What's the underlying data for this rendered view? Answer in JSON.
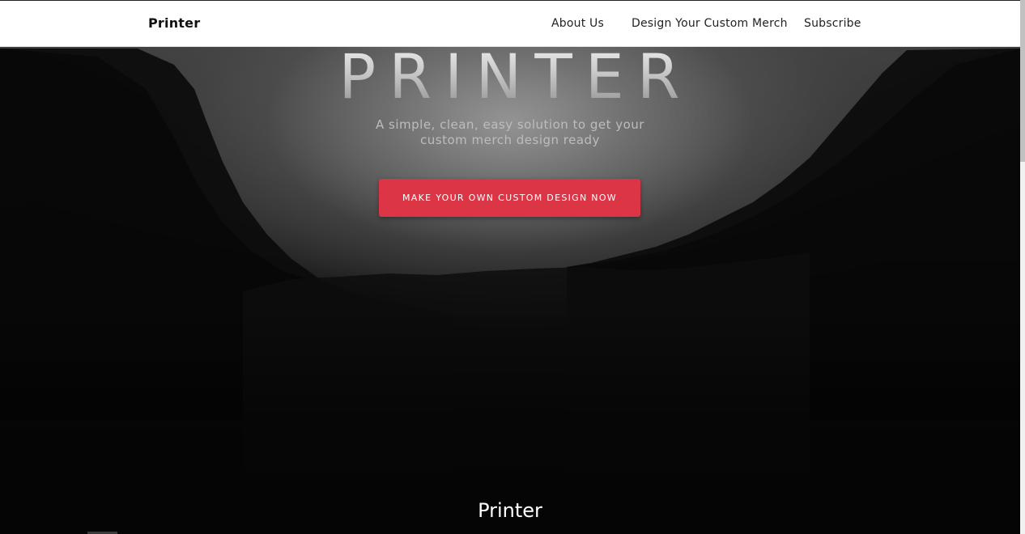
{
  "navbar": {
    "brand": "Printer",
    "links": [
      {
        "label": "About Us"
      },
      {
        "label": "Design Your Custom Merch"
      },
      {
        "label": "Subscribe"
      }
    ]
  },
  "hero": {
    "title": "PRINTER",
    "subtitle": "A simple, clean, easy solution to get your custom merch design ready",
    "cta_label": "MAKE YOUR OWN CUSTOM DESIGN NOW"
  },
  "footer": {
    "title": "Printer"
  },
  "colors": {
    "accent": "#dc3545",
    "navbar_bg": "#ffffff",
    "hero_bg": "#000000"
  }
}
